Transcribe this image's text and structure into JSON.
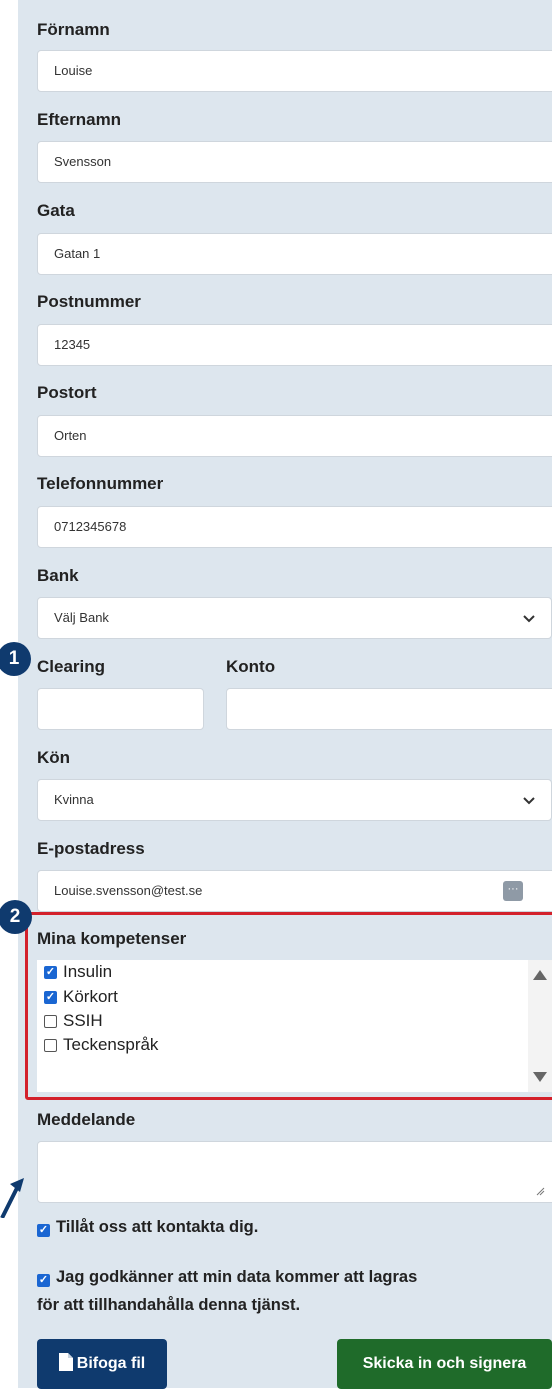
{
  "form": {
    "first_name": {
      "label": "Förnamn",
      "value": "Louise"
    },
    "last_name": {
      "label": "Efternamn",
      "value": "Svensson"
    },
    "street": {
      "label": "Gata",
      "value": "Gatan 1"
    },
    "postal_code": {
      "label": "Postnummer",
      "value": "12345"
    },
    "city": {
      "label": "Postort",
      "value": "Orten"
    },
    "phone": {
      "label": "Telefonnummer",
      "value": "0712345678"
    },
    "bank": {
      "label": "Bank",
      "value": "Välj Bank"
    },
    "clearing": {
      "label": "Clearing",
      "value": ""
    },
    "account": {
      "label": "Konto",
      "value": ""
    },
    "gender": {
      "label": "Kön",
      "value": "Kvinna"
    },
    "email": {
      "label": "E-postadress",
      "value": "Louise.svensson@test.se"
    },
    "competences": {
      "label": "Mina kompetenser",
      "options": [
        {
          "label": "Insulin",
          "checked": true
        },
        {
          "label": "Körkort",
          "checked": true
        },
        {
          "label": "SSIH",
          "checked": false
        },
        {
          "label": "Teckenspråk",
          "checked": false
        }
      ]
    },
    "message": {
      "label": "Meddelande",
      "value": ""
    },
    "contact_consent": {
      "label": "Tillåt oss att kontakta dig.",
      "checked": true
    },
    "data_consent": {
      "line1": "Jag godkänner att min data kommer att lagras",
      "line2": "för att tillhandahålla denna tjänst.",
      "checked": true
    }
  },
  "annotations": {
    "badge1": "1",
    "badge2": "2"
  },
  "buttons": {
    "attach": "Bifoga fil",
    "submit": "Skicka in och signera"
  },
  "colors": {
    "panel": "#dde6ee",
    "badge": "#0f3a6e",
    "highlight": "#d3212c",
    "checkbox": "#1a66d2",
    "attach_button": "#0f3a6e",
    "submit_button": "#1f6b2a"
  },
  "icons": {
    "select_arrow": "chevron-down-icon",
    "file": "file-icon",
    "password_manager": "dots-icon",
    "resize": "resize-handle-icon"
  }
}
